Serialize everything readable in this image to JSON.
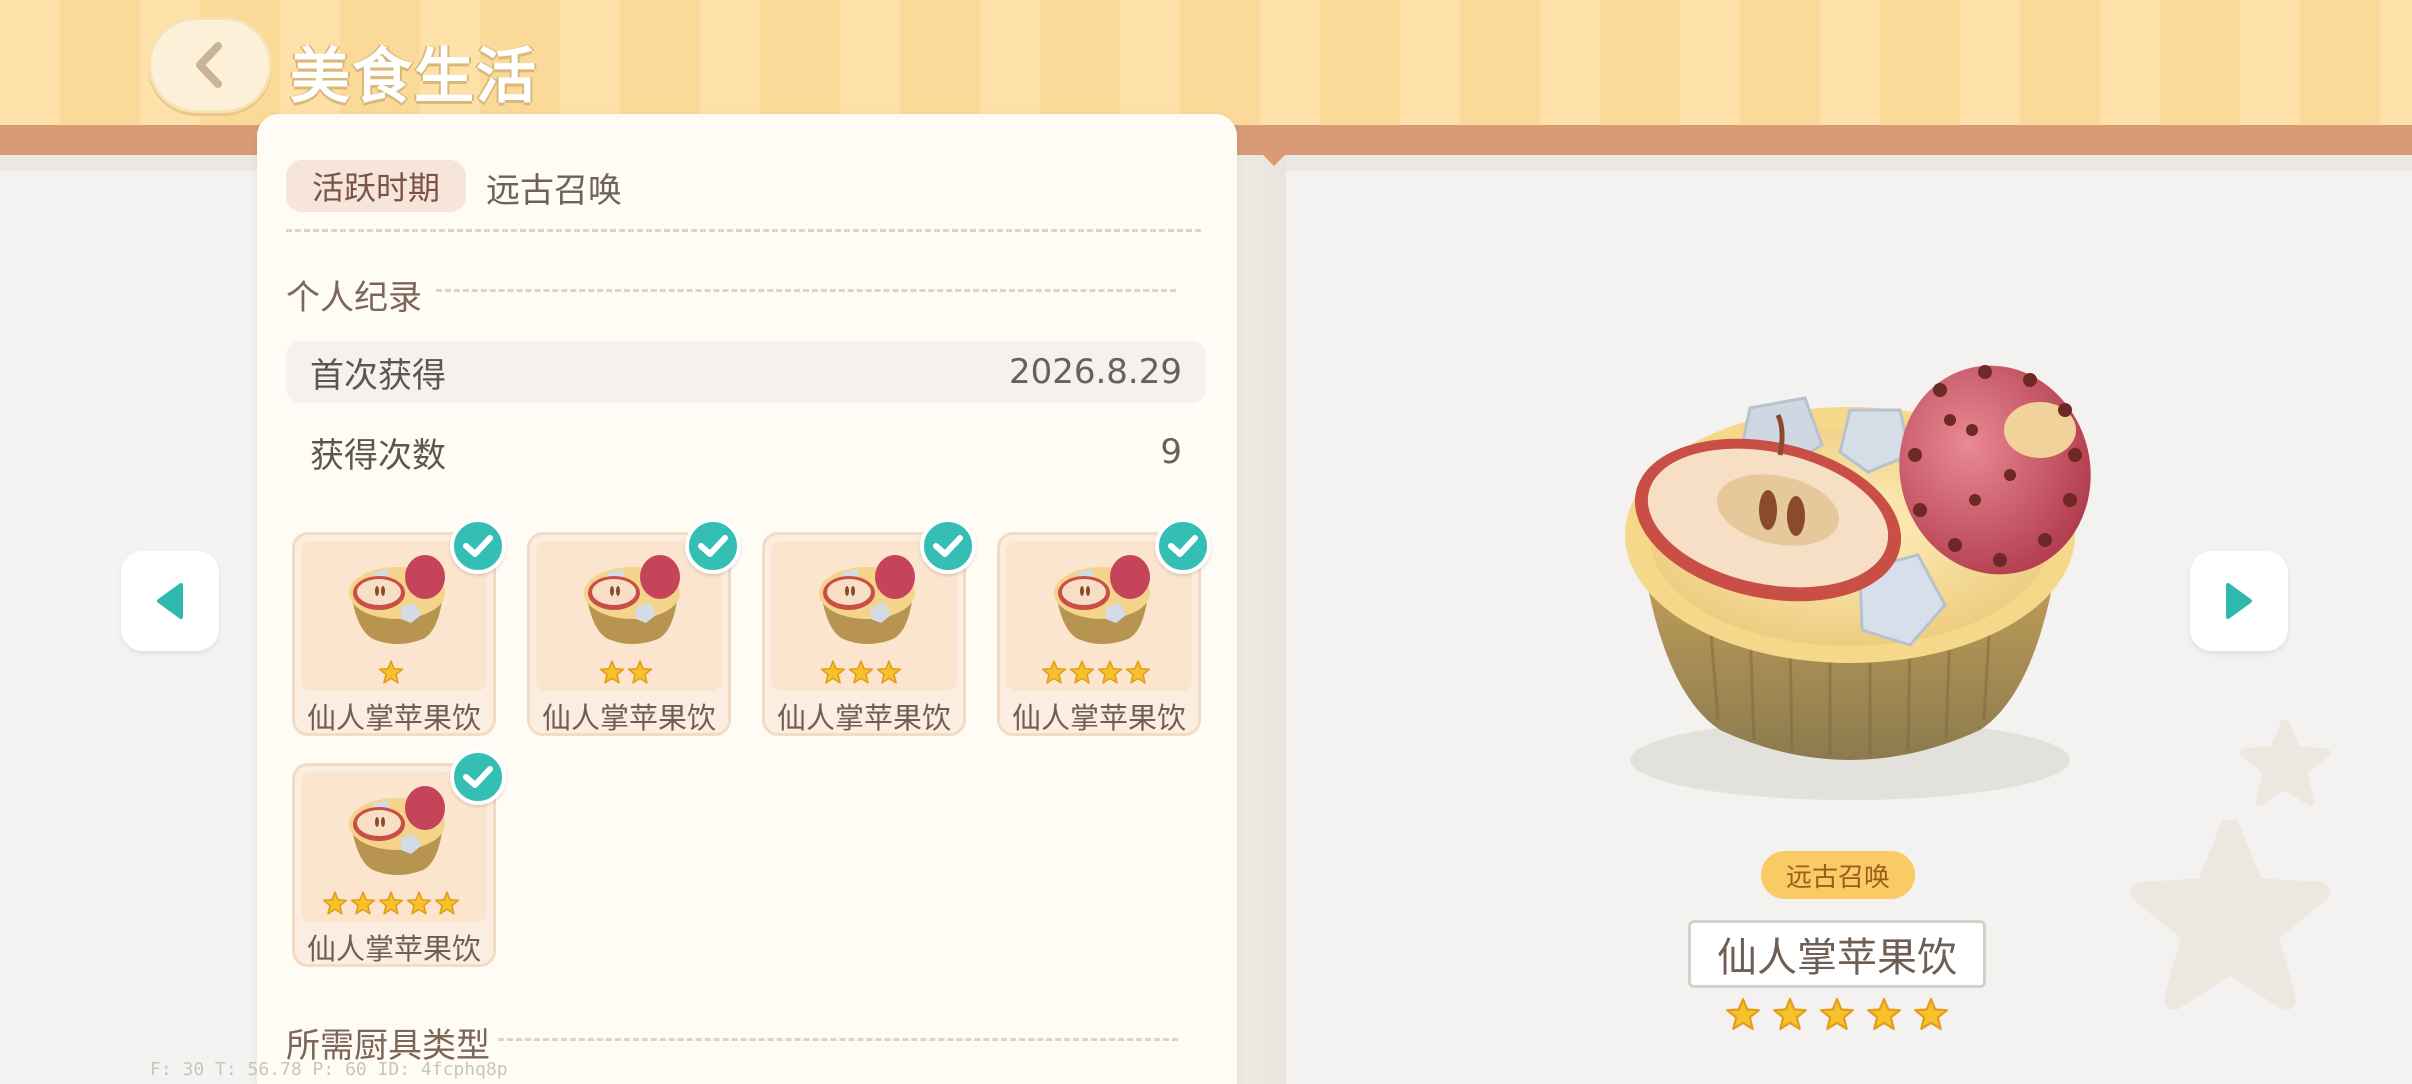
{
  "header": {
    "title": "美食生活"
  },
  "panel": {
    "period_label": "活跃时期",
    "period_value": "远古召唤",
    "personal_record_title": "个人纪录",
    "records": [
      {
        "label": "首次获得",
        "value": "2026.8.29"
      },
      {
        "label": "获得次数",
        "value": "9"
      }
    ],
    "cards": [
      {
        "name": "仙人掌苹果饮",
        "stars": 1,
        "collected": true
      },
      {
        "name": "仙人掌苹果饮",
        "stars": 2,
        "collected": true
      },
      {
        "name": "仙人掌苹果饮",
        "stars": 3,
        "collected": true
      },
      {
        "name": "仙人掌苹果饮",
        "stars": 4,
        "collected": true
      },
      {
        "name": "仙人掌苹果饮",
        "stars": 5,
        "collected": true
      }
    ],
    "tool_section_title": "所需厨具类型"
  },
  "detail": {
    "tag": "远古召唤",
    "name": "仙人掌苹果饮",
    "stars": 5
  },
  "debug": {
    "text": "F: 30    T: 56.78    P: 60    ID: 4fcphq8p"
  },
  "colors": {
    "header_bg": "#fbd998",
    "accent_stripe": "#d99a76",
    "check_teal": "#35bfb4",
    "arrow_teal": "#2fb8ad",
    "star_gold": "#f6c22b",
    "tag_bg": "#f9cb64"
  },
  "icons": {
    "back": "chevron-left-icon",
    "prev": "triangle-left-icon",
    "next": "triangle-right-icon",
    "check": "check-icon",
    "star": "star-icon"
  }
}
